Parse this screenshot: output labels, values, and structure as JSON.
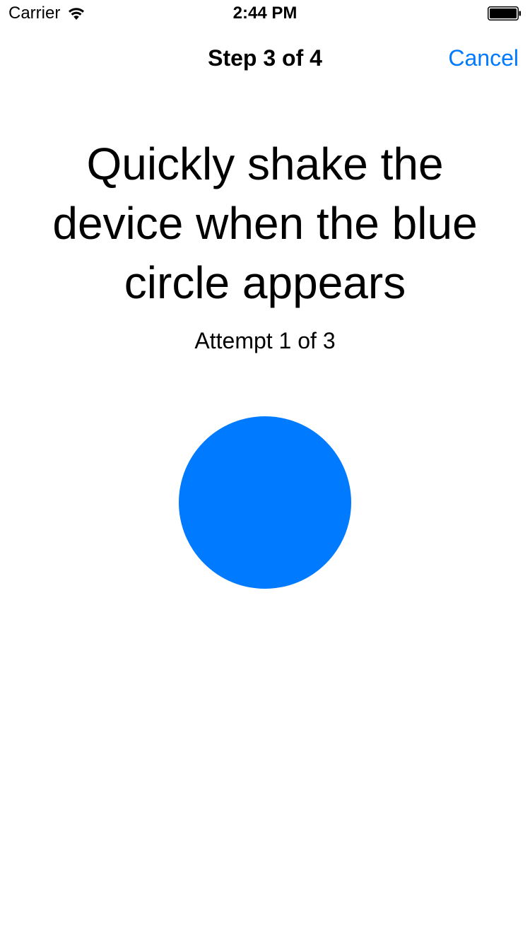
{
  "status_bar": {
    "carrier": "Carrier",
    "time": "2:44 PM",
    "wifi_icon": "wifi-icon",
    "battery_icon": "battery-icon",
    "battery_level": 1.0
  },
  "nav_bar": {
    "title": "Step 3 of 4",
    "cancel_label": "Cancel"
  },
  "content": {
    "instruction": "Quickly shake the device when the blue circle appears",
    "attempt": "Attempt 1 of 3",
    "circle_color": "#007aff"
  },
  "colors": {
    "accent": "#007aff",
    "text": "#000000",
    "background": "#ffffff"
  }
}
